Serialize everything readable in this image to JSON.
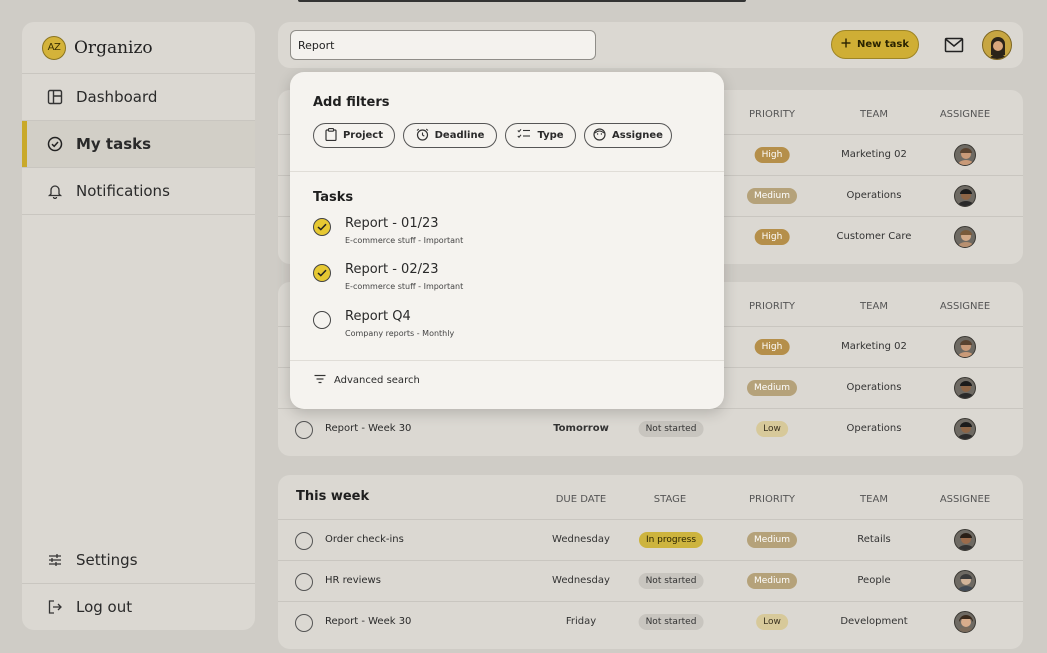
{
  "brand": {
    "logo_text": "AZ",
    "name": "Organizo"
  },
  "sidebar": {
    "items": [
      {
        "label": "Dashboard"
      },
      {
        "label": "My tasks"
      },
      {
        "label": "Notifications"
      }
    ],
    "bottom": [
      {
        "label": "Settings"
      },
      {
        "label": "Log out"
      }
    ]
  },
  "topbar": {
    "search_value": "Report",
    "new_task_label": "New task"
  },
  "columns": {
    "due": "DUE DATE",
    "stage": "STAGE",
    "priority": "PRIORITY",
    "team": "TEAM",
    "assignee": "ASSIGNEE"
  },
  "panel1": {
    "rows": [
      {
        "priority": "High",
        "team": "Marketing 02"
      },
      {
        "priority": "Medium",
        "team": "Operations"
      },
      {
        "priority": "High",
        "team": "Customer Care"
      }
    ]
  },
  "panel2": {
    "rows": [
      {
        "priority": "High",
        "team": "Marketing 02"
      },
      {
        "priority": "Medium",
        "team": "Operations"
      },
      {
        "name": "Report - Week 30",
        "due": "Tomorrow",
        "stage": "Not started",
        "priority": "Low",
        "team": "Operations"
      }
    ]
  },
  "panel3": {
    "title": "This week",
    "rows": [
      {
        "name": "Order check-ins",
        "due": "Wednesday",
        "stage": "In progress",
        "priority": "Medium",
        "team": "Retails"
      },
      {
        "name": "HR reviews",
        "due": "Wednesday",
        "stage": "Not started",
        "priority": "Medium",
        "team": "People"
      },
      {
        "name": "Report - Week 30",
        "due": "Friday",
        "stage": "Not started",
        "priority": "Low",
        "team": "Development"
      }
    ]
  },
  "dropdown": {
    "filters_title": "Add filters",
    "filters": [
      {
        "label": "Project"
      },
      {
        "label": "Deadline"
      },
      {
        "label": "Type"
      },
      {
        "label": "Assignee"
      }
    ],
    "tasks_title": "Tasks",
    "tasks": [
      {
        "title": "Report - 01/23",
        "subtitle": "E-commerce stuff - Important",
        "checked": true
      },
      {
        "title": "Report - 02/23",
        "subtitle": "E-commerce stuff - Important",
        "checked": true
      },
      {
        "title": "Report Q4",
        "subtitle": "Company reports - Monthly",
        "checked": false
      }
    ],
    "advanced_label": "Advanced search"
  },
  "colors": {
    "accent": "#cfae35",
    "background": "#cfccc6",
    "panel": "#dbd8d2",
    "dropdown": "#f5f3ef"
  }
}
